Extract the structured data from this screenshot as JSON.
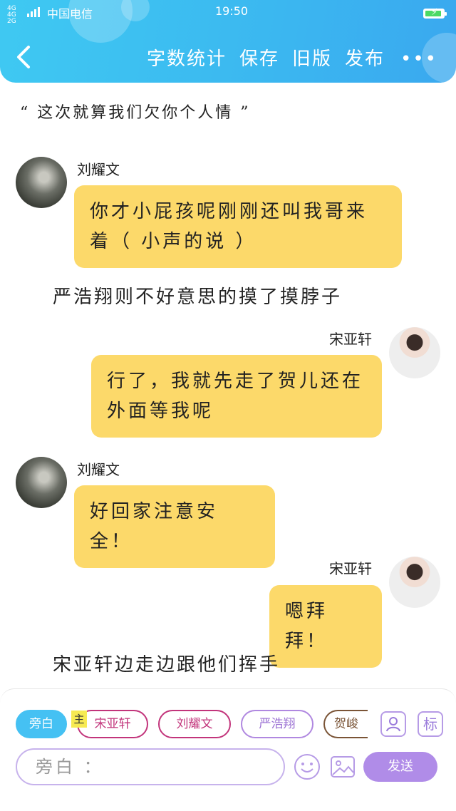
{
  "status": {
    "network": "4G 4G 2G",
    "carrier": "中国电信",
    "time": "19:50",
    "battery_level": 0.9
  },
  "header": {
    "menu": [
      "字数统计",
      "保存",
      "旧版",
      "发布"
    ],
    "more": "•••"
  },
  "content": {
    "quote": "“ 这次就算我们欠你个人情 ”",
    "messages": [
      {
        "name": "刘耀文",
        "text": "你才小屁孩呢刚刚还叫我哥来着（ 小声的说 ）"
      },
      {
        "narration": "严浩翔则不好意思的摸了摸脖子"
      },
      {
        "name": "宋亚轩",
        "text": "行了，我就先走了贺儿还在外面等我呢"
      },
      {
        "name": "刘耀文",
        "text": "好回家注意安全！"
      },
      {
        "name": "宋亚轩",
        "text": "嗯拜拜！"
      },
      {
        "narration": "宋亚轩边走边跟他们挥手"
      }
    ]
  },
  "panel": {
    "roles": [
      "旁白",
      "宋亚轩",
      "刘耀文",
      "严浩翔",
      "贺峻"
    ],
    "main_badge": "主",
    "tool_label": "标",
    "input_placeholder": "旁白 ：",
    "send_label": "发送"
  },
  "colors": {
    "header": "#3bb7f0",
    "bubble": "#fcd96a",
    "accent_purple": "#b08ce8"
  }
}
